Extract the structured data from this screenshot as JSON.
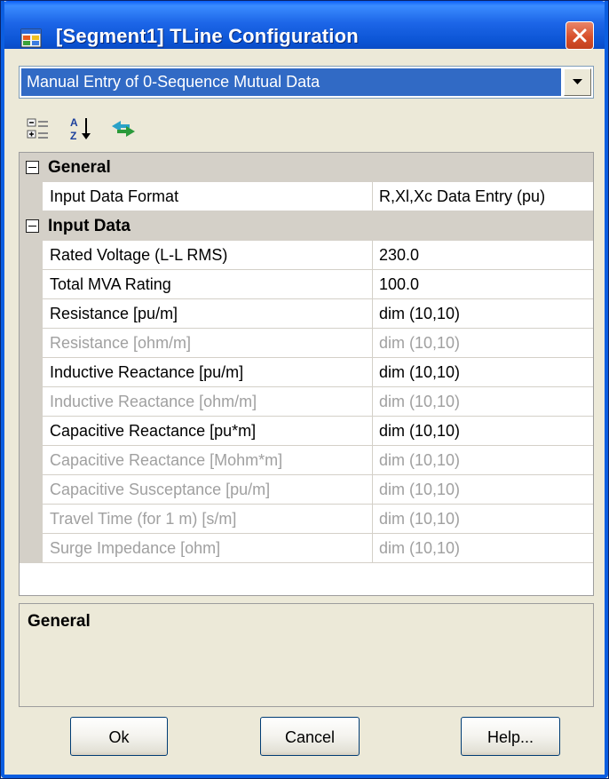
{
  "window": {
    "title": "[Segment1] TLine Configuration",
    "close_label": "Close"
  },
  "entry_mode": {
    "selected": "Manual Entry of 0-Sequence Mutual Data"
  },
  "toolbar": {
    "icons": [
      "categorized-icon",
      "alphabetical-sort-icon",
      "property-pages-icon"
    ]
  },
  "grid": {
    "categories": [
      {
        "label": "General",
        "rows": [
          {
            "name": "Input Data Format",
            "value": "R,Xl,Xc Data Entry (pu)",
            "enabled": true
          }
        ]
      },
      {
        "label": "Input Data",
        "rows": [
          {
            "name": "Rated Voltage (L-L RMS)",
            "value": "230.0",
            "enabled": true
          },
          {
            "name": "Total MVA Rating",
            "value": "100.0",
            "enabled": true
          },
          {
            "name": "Resistance [pu/m]",
            "value": "dim (10,10)",
            "enabled": true
          },
          {
            "name": "Resistance [ohm/m]",
            "value": "dim (10,10)",
            "enabled": false
          },
          {
            "name": "Inductive Reactance [pu/m]",
            "value": "dim (10,10)",
            "enabled": true
          },
          {
            "name": "Inductive Reactance [ohm/m]",
            "value": "dim (10,10)",
            "enabled": false
          },
          {
            "name": "Capacitive Reactance [pu*m]",
            "value": "dim (10,10)",
            "enabled": true
          },
          {
            "name": "Capacitive Reactance [Mohm*m]",
            "value": "dim (10,10)",
            "enabled": false
          },
          {
            "name": "Capacitive Susceptance [pu/m]",
            "value": "dim (10,10)",
            "enabled": false
          },
          {
            "name": "Travel Time (for 1 m) [s/m]",
            "value": "dim (10,10)",
            "enabled": false
          },
          {
            "name": "Surge Impedance [ohm]",
            "value": "dim (10,10)",
            "enabled": false
          }
        ]
      }
    ]
  },
  "help": {
    "title": "General"
  },
  "buttons": {
    "ok": "Ok",
    "cancel": "Cancel",
    "help": "Help..."
  },
  "colors": {
    "titlebar": "#0b54d4",
    "selection": "#316ac5",
    "category_bg": "#d4d0c8",
    "disabled_text": "#a0a0a0",
    "close_button": "#d8502c"
  }
}
